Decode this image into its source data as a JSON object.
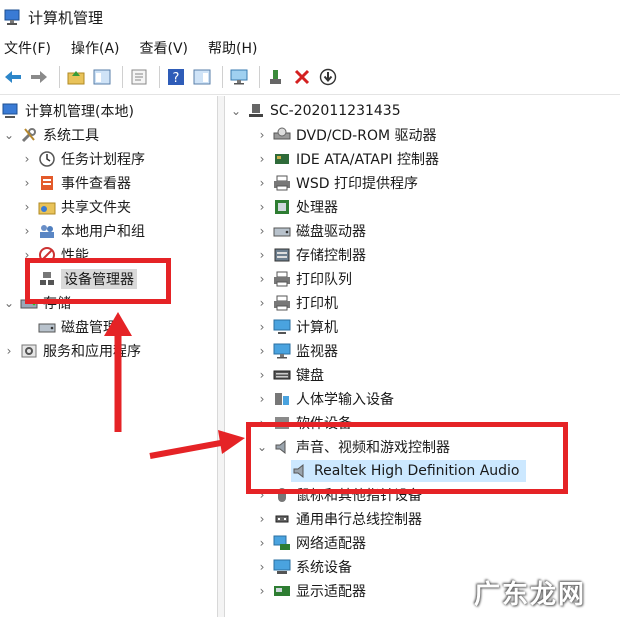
{
  "window": {
    "title": "计算机管理"
  },
  "menu": {
    "file": "文件(F)",
    "action": "操作(A)",
    "view": "查看(V)",
    "help": "帮助(H)"
  },
  "left_tree": {
    "root": "计算机管理(本地)",
    "system_tools": "系统工具",
    "task_scheduler": "任务计划程序",
    "event_viewer": "事件查看器",
    "shared_folders": "共享文件夹",
    "local_users": "本地用户和组",
    "performance": "性能",
    "device_manager": "设备管理器",
    "storage": "存储",
    "disk_management": "磁盘管理",
    "services_apps": "服务和应用程序"
  },
  "right_tree": {
    "computer": "SC-202011231435",
    "items": [
      "DVD/CD-ROM 驱动器",
      "IDE ATA/ATAPI 控制器",
      "WSD 打印提供程序",
      "处理器",
      "磁盘驱动器",
      "存储控制器",
      "打印队列",
      "打印机",
      "计算机",
      "监视器",
      "键盘",
      "人体学输入设备",
      "软件设备",
      "声音、视频和游戏控制器",
      "Realtek High Definition Audio",
      "鼠标和其他指针设备",
      "通用串行总线控制器",
      "网络适配器",
      "系统设备",
      "显示适配器"
    ]
  },
  "watermark": "广东龙网",
  "colors": {
    "annotation_red": "#e52326",
    "selection_blue": "#cce8ff"
  }
}
